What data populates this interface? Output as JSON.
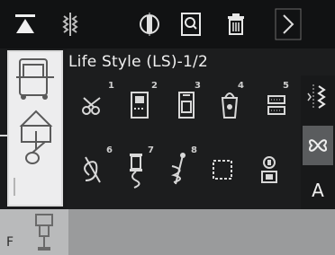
{
  "colors": {
    "background": "#1c1d1e",
    "toolbar": "#111213",
    "selector_panel": "#ededee",
    "bottom_bar": "#9a9b9c",
    "active_button": "#5a5c5e"
  },
  "toolbar": {
    "icons": [
      "bobbin-top-icon",
      "needle-pattern-icon",
      "presser-foot-icon",
      "magnifier-icon",
      "trash-icon",
      "chevron-right-icon"
    ]
  },
  "header": {
    "title": "Life Style (LS)-1/2"
  },
  "stitches": [
    {
      "num": "1",
      "icon": "scissors-thread-icon"
    },
    {
      "num": "2",
      "icon": "jeans-pocket-icon"
    },
    {
      "num": "3",
      "icon": "shirt-pocket-icon"
    },
    {
      "num": "4",
      "icon": "bag-icon"
    },
    {
      "num": "5",
      "icon": "tape-measure-icon"
    },
    {
      "num": "6",
      "icon": "needle-loop-icon"
    },
    {
      "num": "7",
      "icon": "spool-icon"
    },
    {
      "num": "8",
      "icon": "pin-icon"
    },
    {
      "num": "",
      "icon": "dashed-square-icon"
    },
    {
      "num": "",
      "icon": "memory-pattern-icon"
    }
  ],
  "right_panel": {
    "buttons": [
      "needle-position-icon",
      "mirror-stitch-icon",
      "font-a-label"
    ],
    "font_label": "A"
  },
  "bottom": {
    "label": "F"
  }
}
